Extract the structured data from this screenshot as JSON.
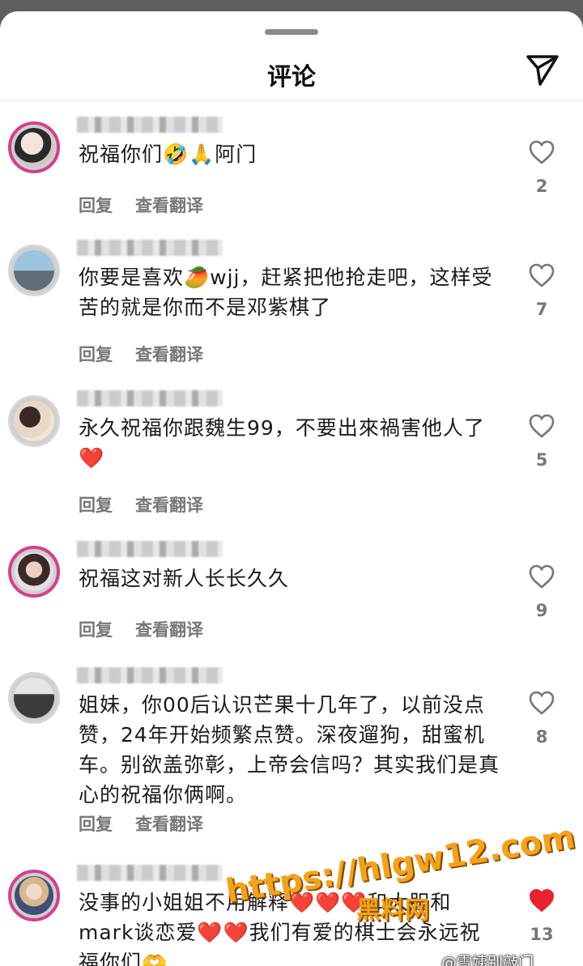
{
  "header": {
    "title": "评论"
  },
  "comments": [
    {
      "text": "祝福你们🤣🙏阿门",
      "reply_label": "回复",
      "translate_label": "查看翻译",
      "likes": "2",
      "liked": false,
      "story_ring": true
    },
    {
      "text": "你要是喜欢🥭wjj，赶紧把他抢走吧，这样受苦的就是你而不是邓紫棋了",
      "reply_label": "回复",
      "translate_label": "查看翻译",
      "likes": "7",
      "liked": false,
      "story_ring": false
    },
    {
      "text": "永久祝福你跟魏生99，不要出來禍害他人了❤️",
      "reply_label": "回复",
      "translate_label": "查看翻译",
      "likes": "5",
      "liked": false,
      "story_ring": false
    },
    {
      "text": "祝福这对新人长长久久",
      "reply_label": "回复",
      "translate_label": "查看翻译",
      "likes": "9",
      "liked": false,
      "story_ring": true
    },
    {
      "text": "姐妹，你00后认识芒果十几年了，以前没点赞，24年开始频繁点赞。深夜遛狗，甜蜜机车。别欲盖弥彰，上帝会信吗？其实我们是真心的祝福你俩啊。",
      "reply_label": "回复",
      "translate_label": "查看翻译",
      "likes": "8",
      "liked": false,
      "story_ring": false
    },
    {
      "text": "没事的小姐姐不用解释❤️❤️❤️和大胆和mark谈恋爱❤️❤️我们有爱的棋士会永远祝福你们🫶",
      "likes": "13",
      "liked": true,
      "story_ring": true
    }
  ],
  "watermark": {
    "url": "https://hlgw12.com",
    "site": "黑料网",
    "weibo": "@雪姨别敲门"
  },
  "colors": {
    "liked_heart": "#e8222f",
    "story_ring": "#d43f8d"
  }
}
